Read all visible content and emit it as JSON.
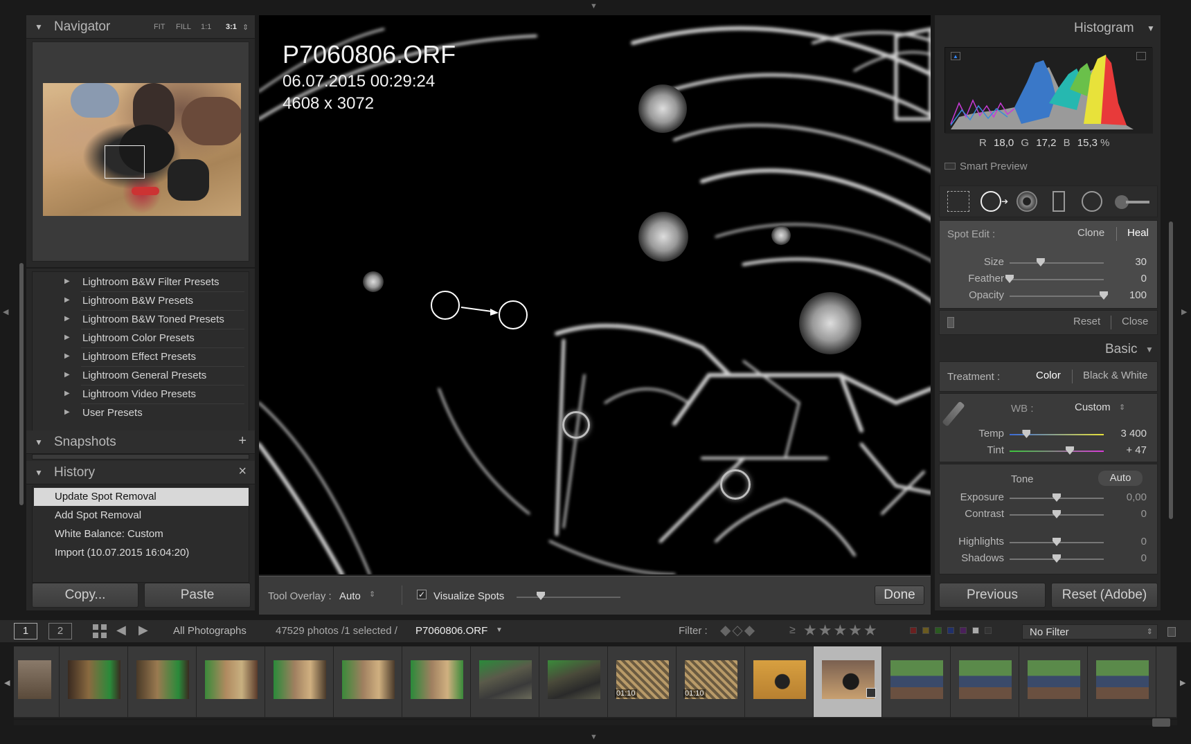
{
  "navigator": {
    "title": "Navigator",
    "zoom": [
      "FIT",
      "FILL",
      "1:1",
      "3:1"
    ]
  },
  "presets": [
    "Lightroom B&W Filter Presets",
    "Lightroom B&W Presets",
    "Lightroom B&W Toned Presets",
    "Lightroom Color Presets",
    "Lightroom Effect Presets",
    "Lightroom General Presets",
    "Lightroom Video Presets",
    "User Presets"
  ],
  "snapshots": {
    "title": "Snapshots",
    "add": "+"
  },
  "history": {
    "title": "History",
    "close": "×",
    "items": [
      "Update Spot Removal",
      "Add Spot Removal",
      "White Balance: Custom",
      "Import (10.07.2015 16:04:20)"
    ]
  },
  "left_buttons": {
    "copy": "Copy...",
    "paste": "Paste"
  },
  "image": {
    "filename": "P7060806.ORF",
    "date": "06.07.2015 00:29:24",
    "dimensions": "4608 x 3072"
  },
  "toolbar": {
    "overlay_label": "Tool Overlay :",
    "overlay_value": "Auto",
    "visualize_label": "Visualize Spots",
    "visualize_checked": true,
    "done": "Done"
  },
  "histogram": {
    "title": "Histogram",
    "r_label": "R",
    "r_value": "18,0",
    "g_label": "G",
    "g_value": "17,2",
    "b_label": "B",
    "b_value": "15,3",
    "percent": "%",
    "smart_preview": "Smart Preview"
  },
  "spot_edit": {
    "label": "Spot Edit :",
    "clone": "Clone",
    "heal": "Heal",
    "sliders": [
      {
        "label": "Size",
        "value": "30",
        "level": 0.33
      },
      {
        "label": "Feather",
        "value": "0",
        "level": 0.0
      },
      {
        "label": "Opacity",
        "value": "100",
        "level": 1.0
      }
    ],
    "reset": "Reset",
    "close": "Close"
  },
  "basic": {
    "title": "Basic",
    "treatment_label": "Treatment :",
    "color": "Color",
    "bw": "Black & White",
    "wb_label": "WB :",
    "wb_value": "Custom",
    "temp_label": "Temp",
    "temp_value": "3 400",
    "temp_level": 0.18,
    "tint_label": "Tint",
    "tint_value": "+ 47",
    "tint_level": 0.64,
    "tone_label": "Tone",
    "auto": "Auto",
    "tone_sliders": [
      {
        "label": "Exposure",
        "value": "0,00",
        "level": 0.5
      },
      {
        "label": "Contrast",
        "value": "0",
        "level": 0.5
      },
      {
        "label": "Highlights",
        "value": "0",
        "level": 0.5
      },
      {
        "label": "Shadows",
        "value": "0",
        "level": 0.5
      }
    ]
  },
  "right_buttons": {
    "previous": "Previous",
    "reset": "Reset (Adobe)"
  },
  "filmbar": {
    "view1": "1",
    "view2": "2",
    "source": "All Photographs",
    "count": "47529 photos /1 selected /",
    "selected_file": "P7060806.ORF",
    "filter_label": "Filter :",
    "gte": "≥",
    "stars": "★★★★★",
    "filter_value": "No Filter"
  },
  "filmstrip": {
    "durations": [
      "01:10",
      "01:10"
    ]
  }
}
